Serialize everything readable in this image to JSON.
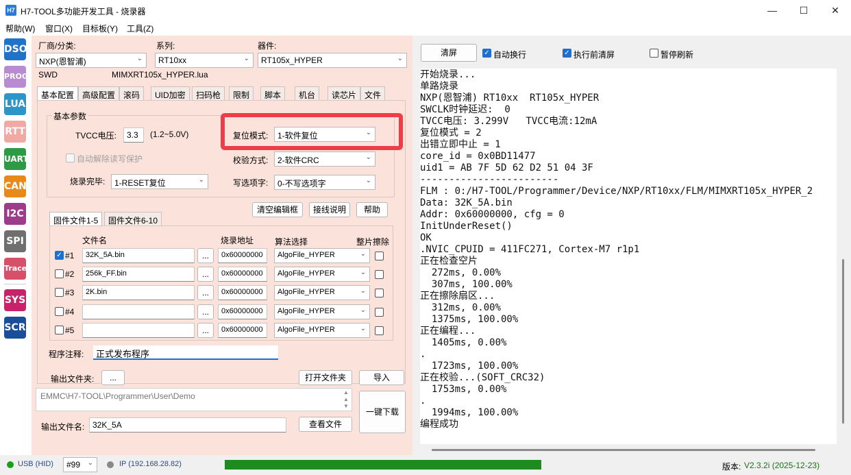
{
  "window": {
    "title": "H7-TOOL多功能开发工具 - 烧录器",
    "icon_text": "H7"
  },
  "menu": [
    "帮助(W)",
    "窗口(X)",
    "目标板(Y)",
    "工具(Z)"
  ],
  "sidebar": [
    {
      "label": "DSO",
      "color": "#1f73c9"
    },
    {
      "label": "PROG",
      "color": "#b98bd0"
    },
    {
      "label": "LUA",
      "color": "#2e95c8"
    },
    {
      "label": "RTT",
      "color": "#f0a9a3"
    },
    {
      "label": "UART",
      "color": "#2e9a46"
    },
    {
      "label": "CAN",
      "color": "#e88a1a"
    },
    {
      "label": "I2C",
      "color": "#9c3c8a"
    },
    {
      "label": "SPI",
      "color": "#6f6f6f"
    },
    {
      "label": "Trace",
      "color": "#d6506a"
    },
    {
      "label": "SYS",
      "color": "#c8226a"
    },
    {
      "label": "SCR",
      "color": "#1a4e9a"
    }
  ],
  "device": {
    "vendor_label": "厂商/分类:",
    "vendor_value": "NXP(恩智浦)",
    "series_label": "系列:",
    "series_value": "RT10xx",
    "part_label": "器件:",
    "part_value": "RT105x_HYPER",
    "interface": "SWD",
    "lua_file": "MIMXRT105x_HYPER.lua"
  },
  "tabs": [
    "基本配置",
    "高级配置",
    "滚码",
    "UID加密",
    "扫码枪",
    "限制",
    "脚本",
    "机台",
    "读芯片",
    "文件"
  ],
  "basic": {
    "group_title": "基本参数",
    "tvcc_label": "TVCC电压:",
    "tvcc_value": "3.3",
    "tvcc_range": "(1.2~5.0V)",
    "auto_unlock_label": "自动解除读写保护",
    "after_label": "烧录完毕:",
    "after_value": "1-RESET复位",
    "reset_label": "复位模式:",
    "reset_value": "1-软件复位",
    "verify_label": "校验方式:",
    "verify_value": "2-软件CRC",
    "option_label": "写选项字:",
    "option_value": "0-不写选项字"
  },
  "buttons": {
    "clear_editor": "清空编辑框",
    "wiring": "接线说明",
    "help": "帮助"
  },
  "filetabs": [
    "固件文件1-5",
    "固件文件6-10"
  ],
  "file_headers": {
    "name": "文件名",
    "address": "烧录地址",
    "algo": "算法选择",
    "erase": "整片擦除"
  },
  "files": [
    {
      "checked": true,
      "idx": "#1",
      "name": "32K_5A.bin",
      "browse": "...",
      "address": "0x60000000",
      "algo": "AlgoFile_HYPER"
    },
    {
      "checked": false,
      "idx": "#2",
      "name": "256k_FF.bin",
      "browse": "...",
      "address": "0x60000000",
      "algo": "AlgoFile_HYPER"
    },
    {
      "checked": false,
      "idx": "#3",
      "name": "2K.bin",
      "browse": "...",
      "address": "0x60000000",
      "algo": "AlgoFile_HYPER"
    },
    {
      "checked": false,
      "idx": "#4",
      "name": "",
      "browse": "...",
      "address": "0x60000000",
      "algo": "AlgoFile_HYPER"
    },
    {
      "checked": false,
      "idx": "#5",
      "name": "",
      "browse": "...",
      "address": "0x60000000",
      "algo": "AlgoFile_HYPER"
    }
  ],
  "note": {
    "label": "程序注释:",
    "value": "正式发布程序"
  },
  "output": {
    "folder_label": "输出文件夹:",
    "folder_browse": "...",
    "open_folder": "打开文件夹",
    "import": "导入",
    "path": "EMMC\\H7-TOOL\\Programmer\\User\\Demo",
    "download": "一键下载",
    "filename_label": "输出文件名:",
    "filename_value": "32K_5A",
    "view_file": "查看文件"
  },
  "console_toolbar": {
    "clear": "清屏",
    "auto_wrap": "自动换行",
    "clear_before": "执行前清屏",
    "pause": "暂停刷新"
  },
  "console_lines": [
    "开始烧录...",
    "单路烧录",
    "NXP(恩智浦) RT10xx  RT105x_HYPER",
    "SWCLK时钟延迟:  0",
    "TVCC电压: 3.299V   TVCC电流:12mA",
    "复位模式 = 2",
    "出错立即中止 = 1",
    "core_id = 0x0BD11477",
    "uid1 = AB 7F 5D 62 D2 51 04 3F",
    "------------------------",
    "FLM : 0:/H7-TOOL/Programmer/Device/NXP/RT10xx/FLM/MIMXRT105x_HYPER_2",
    "Data: 32K_5A.bin",
    "Addr: 0x60000000, cfg = 0",
    "InitUnderReset()",
    "OK",
    ".NVIC_CPUID = 411FC271, Cortex-M7 r1p1",
    "正在检查空片",
    "  272ms, 0.00%",
    "  307ms, 100.00%",
    "正在擦除扇区...",
    "  312ms, 0.00%",
    "  1375ms, 100.00%",
    "正在编程...",
    "  1405ms, 0.00%",
    ".",
    "  1723ms, 100.00%",
    "正在校验...(SOFT_CRC32)",
    "  1753ms, 0.00%",
    ".",
    "  1994ms, 100.00%",
    "编程成功"
  ],
  "status": {
    "usb": "USB (HID)",
    "port": "#99",
    "ip": "IP (192.168.28.82)",
    "progress": 1.0,
    "version_label": "版本:",
    "version_value": "V2.3.2i (2025-12-23)"
  },
  "colors": {
    "left_panel": "#fbe3dc",
    "highlight": "#ee3d48",
    "progress": "#1e8b1e",
    "status_ok": "#18a018",
    "version": "#1c6e1c"
  }
}
